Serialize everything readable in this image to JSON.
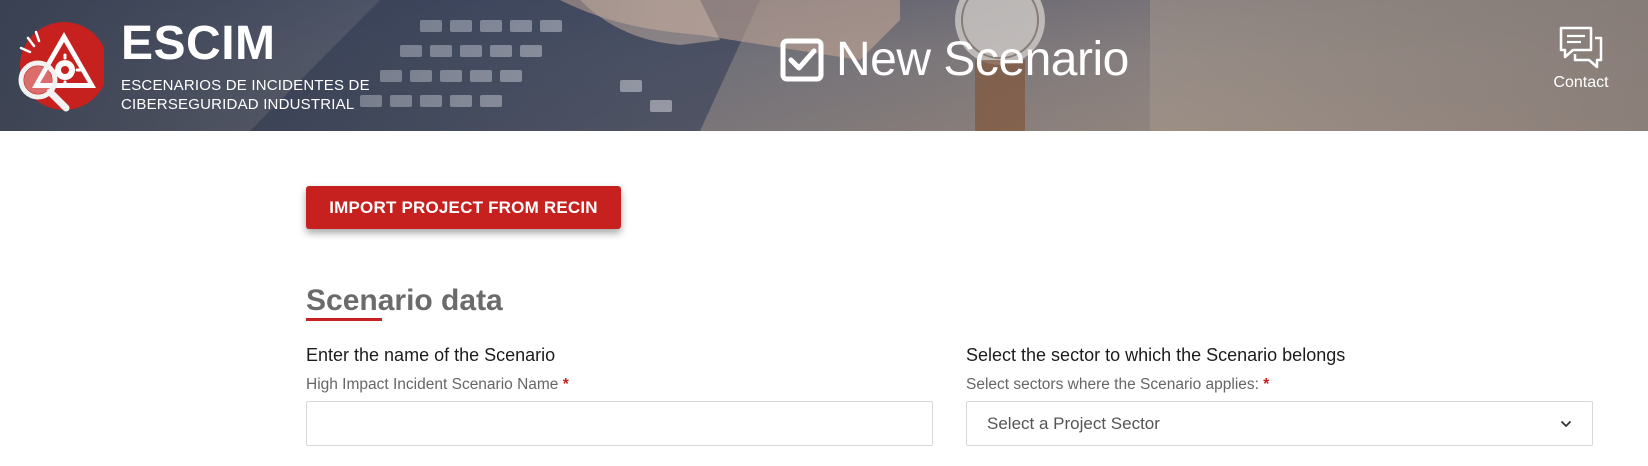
{
  "header": {
    "brand": {
      "name": "ESCIM",
      "subtitle": "ESCENARIOS DE INCIDENTES DE CIBERSEGURIDAD INDUSTRIAL",
      "logo_icon": "alert-gear-magnifier-icon"
    },
    "page_title": "New Scenario",
    "title_icon": "checkbox-checked-icon",
    "contact": {
      "label": "Contact",
      "icon": "chat-bubbles-icon"
    }
  },
  "main": {
    "import_button_label": "IMPORT PROJECT FROM RECIN",
    "section_title": "Scenario data",
    "name_field": {
      "heading": "Enter the name of the Scenario",
      "label": "High Impact Incident Scenario Name",
      "required_mark": "*",
      "value": "",
      "placeholder": ""
    },
    "sector_field": {
      "heading": "Select the sector to which the Scenario belongs",
      "label": "Select sectors where the Scenario applies:",
      "required_mark": "*",
      "selected": "Select a Project Sector"
    }
  },
  "colors": {
    "accent": "#c6211f",
    "section_title": "#6b6b6b",
    "label": "#666666"
  }
}
